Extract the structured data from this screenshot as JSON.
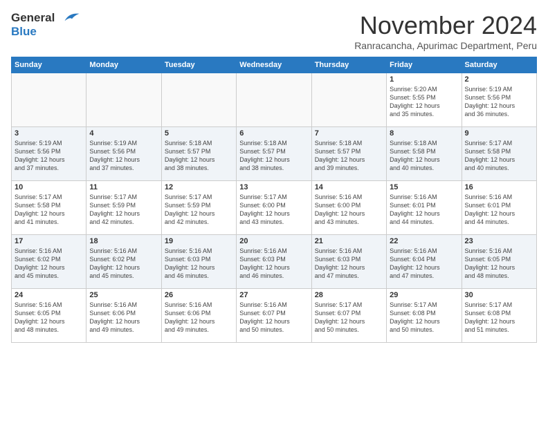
{
  "header": {
    "logo_line1": "General",
    "logo_line2": "Blue",
    "month": "November 2024",
    "location": "Ranracancha, Apurimac Department, Peru"
  },
  "weekdays": [
    "Sunday",
    "Monday",
    "Tuesday",
    "Wednesday",
    "Thursday",
    "Friday",
    "Saturday"
  ],
  "weeks": [
    [
      {
        "day": "",
        "info": ""
      },
      {
        "day": "",
        "info": ""
      },
      {
        "day": "",
        "info": ""
      },
      {
        "day": "",
        "info": ""
      },
      {
        "day": "",
        "info": ""
      },
      {
        "day": "1",
        "info": "Sunrise: 5:20 AM\nSunset: 5:55 PM\nDaylight: 12 hours\nand 35 minutes."
      },
      {
        "day": "2",
        "info": "Sunrise: 5:19 AM\nSunset: 5:56 PM\nDaylight: 12 hours\nand 36 minutes."
      }
    ],
    [
      {
        "day": "3",
        "info": "Sunrise: 5:19 AM\nSunset: 5:56 PM\nDaylight: 12 hours\nand 37 minutes."
      },
      {
        "day": "4",
        "info": "Sunrise: 5:19 AM\nSunset: 5:56 PM\nDaylight: 12 hours\nand 37 minutes."
      },
      {
        "day": "5",
        "info": "Sunrise: 5:18 AM\nSunset: 5:57 PM\nDaylight: 12 hours\nand 38 minutes."
      },
      {
        "day": "6",
        "info": "Sunrise: 5:18 AM\nSunset: 5:57 PM\nDaylight: 12 hours\nand 38 minutes."
      },
      {
        "day": "7",
        "info": "Sunrise: 5:18 AM\nSunset: 5:57 PM\nDaylight: 12 hours\nand 39 minutes."
      },
      {
        "day": "8",
        "info": "Sunrise: 5:18 AM\nSunset: 5:58 PM\nDaylight: 12 hours\nand 40 minutes."
      },
      {
        "day": "9",
        "info": "Sunrise: 5:17 AM\nSunset: 5:58 PM\nDaylight: 12 hours\nand 40 minutes."
      }
    ],
    [
      {
        "day": "10",
        "info": "Sunrise: 5:17 AM\nSunset: 5:58 PM\nDaylight: 12 hours\nand 41 minutes."
      },
      {
        "day": "11",
        "info": "Sunrise: 5:17 AM\nSunset: 5:59 PM\nDaylight: 12 hours\nand 42 minutes."
      },
      {
        "day": "12",
        "info": "Sunrise: 5:17 AM\nSunset: 5:59 PM\nDaylight: 12 hours\nand 42 minutes."
      },
      {
        "day": "13",
        "info": "Sunrise: 5:17 AM\nSunset: 6:00 PM\nDaylight: 12 hours\nand 43 minutes."
      },
      {
        "day": "14",
        "info": "Sunrise: 5:16 AM\nSunset: 6:00 PM\nDaylight: 12 hours\nand 43 minutes."
      },
      {
        "day": "15",
        "info": "Sunrise: 5:16 AM\nSunset: 6:01 PM\nDaylight: 12 hours\nand 44 minutes."
      },
      {
        "day": "16",
        "info": "Sunrise: 5:16 AM\nSunset: 6:01 PM\nDaylight: 12 hours\nand 44 minutes."
      }
    ],
    [
      {
        "day": "17",
        "info": "Sunrise: 5:16 AM\nSunset: 6:02 PM\nDaylight: 12 hours\nand 45 minutes."
      },
      {
        "day": "18",
        "info": "Sunrise: 5:16 AM\nSunset: 6:02 PM\nDaylight: 12 hours\nand 45 minutes."
      },
      {
        "day": "19",
        "info": "Sunrise: 5:16 AM\nSunset: 6:03 PM\nDaylight: 12 hours\nand 46 minutes."
      },
      {
        "day": "20",
        "info": "Sunrise: 5:16 AM\nSunset: 6:03 PM\nDaylight: 12 hours\nand 46 minutes."
      },
      {
        "day": "21",
        "info": "Sunrise: 5:16 AM\nSunset: 6:03 PM\nDaylight: 12 hours\nand 47 minutes."
      },
      {
        "day": "22",
        "info": "Sunrise: 5:16 AM\nSunset: 6:04 PM\nDaylight: 12 hours\nand 47 minutes."
      },
      {
        "day": "23",
        "info": "Sunrise: 5:16 AM\nSunset: 6:05 PM\nDaylight: 12 hours\nand 48 minutes."
      }
    ],
    [
      {
        "day": "24",
        "info": "Sunrise: 5:16 AM\nSunset: 6:05 PM\nDaylight: 12 hours\nand 48 minutes."
      },
      {
        "day": "25",
        "info": "Sunrise: 5:16 AM\nSunset: 6:06 PM\nDaylight: 12 hours\nand 49 minutes."
      },
      {
        "day": "26",
        "info": "Sunrise: 5:16 AM\nSunset: 6:06 PM\nDaylight: 12 hours\nand 49 minutes."
      },
      {
        "day": "27",
        "info": "Sunrise: 5:16 AM\nSunset: 6:07 PM\nDaylight: 12 hours\nand 50 minutes."
      },
      {
        "day": "28",
        "info": "Sunrise: 5:17 AM\nSunset: 6:07 PM\nDaylight: 12 hours\nand 50 minutes."
      },
      {
        "day": "29",
        "info": "Sunrise: 5:17 AM\nSunset: 6:08 PM\nDaylight: 12 hours\nand 50 minutes."
      },
      {
        "day": "30",
        "info": "Sunrise: 5:17 AM\nSunset: 6:08 PM\nDaylight: 12 hours\nand 51 minutes."
      }
    ]
  ]
}
